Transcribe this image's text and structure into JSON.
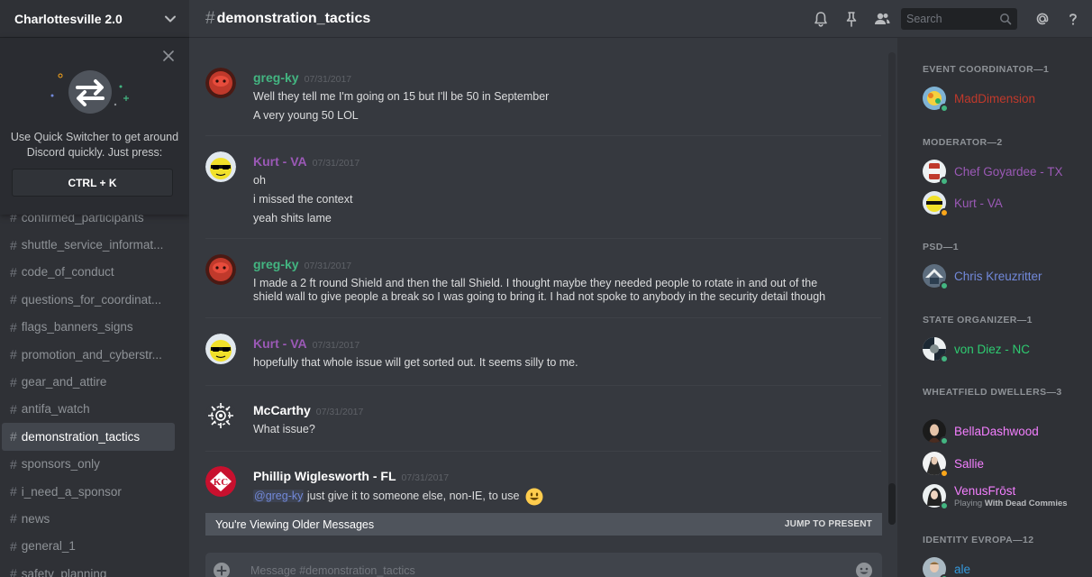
{
  "server": {
    "name": "Charlottesville 2.0"
  },
  "quick_switcher": {
    "text": "Use Quick Switcher to get around Discord quickly. Just press:",
    "key": "CTRL + K"
  },
  "channels": [
    {
      "name": "confirmed_participants",
      "active": false
    },
    {
      "name": "shuttle_service_informat...",
      "active": false
    },
    {
      "name": "code_of_conduct",
      "active": false
    },
    {
      "name": "questions_for_coordinat...",
      "active": false
    },
    {
      "name": "flags_banners_signs",
      "active": false
    },
    {
      "name": "promotion_and_cyberstr...",
      "active": false
    },
    {
      "name": "gear_and_attire",
      "active": false
    },
    {
      "name": "antifa_watch",
      "active": false
    },
    {
      "name": "demonstration_tactics",
      "active": true
    },
    {
      "name": "sponsors_only",
      "active": false
    },
    {
      "name": "i_need_a_sponsor",
      "active": false
    },
    {
      "name": "news",
      "active": false
    },
    {
      "name": "general_1",
      "active": false
    },
    {
      "name": "safety_planning",
      "active": false
    }
  ],
  "header": {
    "channel_name": "demonstration_tactics",
    "search_placeholder": "Search"
  },
  "messages": [
    {
      "author": "greg-ky",
      "author_color": "#43b581",
      "timestamp": "07/31/2017",
      "lines": [
        "Well they tell me I'm going on 15 but I'll be 50 in September",
        "A very young 50 LOL"
      ]
    },
    {
      "author": "Kurt - VA",
      "author_color": "#9b59b6",
      "timestamp": "07/31/2017",
      "lines": [
        "oh",
        "i missed the context",
        "yeah shits lame"
      ]
    },
    {
      "author": "greg-ky",
      "author_color": "#43b581",
      "timestamp": "07/31/2017",
      "lines": [
        "I made a 2 ft round Shield and then the tall Shield. I thought maybe they needed people to rotate in and out of the",
        "shield wall to give people a break so I was going to bring it. I had not spoke to anybody in the security detail though"
      ]
    },
    {
      "author": "Kurt - VA",
      "author_color": "#9b59b6",
      "timestamp": "07/31/2017",
      "lines": [
        "hopefully that whole issue will get sorted out. It seems silly to me."
      ]
    },
    {
      "author": "McCarthy",
      "author_color": "#ffffff",
      "timestamp": "07/31/2017",
      "lines": [
        "What issue?"
      ]
    },
    {
      "author": "Phillip Wiglesworth - FL",
      "author_color": "#ffffff",
      "timestamp": "07/31/2017",
      "mention": "@greg-ky",
      "text_after_mention": " just give it to someone else, non-IE, to use"
    }
  ],
  "older_bar": {
    "text": "You're Viewing Older Messages",
    "jump": "JUMP TO PRESENT"
  },
  "composer": {
    "placeholder": "Message #demonstration_tactics"
  },
  "member_groups": [
    {
      "role": "EVENT COORDINATOR—1",
      "members": [
        {
          "name": "MadDimension",
          "color": "#c0392b",
          "status": "#43b581"
        }
      ]
    },
    {
      "role": "MODERATOR—2",
      "members": [
        {
          "name": "Chef Goyardee - TX",
          "color": "#9b59b6",
          "status": "#43b581"
        },
        {
          "name": "Kurt - VA",
          "color": "#9b59b6",
          "status": "#faa61a"
        }
      ]
    },
    {
      "role": "PSD—1",
      "members": [
        {
          "name": "Chris Kreuzritter",
          "color": "#7289da",
          "status": "#43b581"
        }
      ]
    },
    {
      "role": "STATE ORGANIZER—1",
      "members": [
        {
          "name": "von Diez - NC",
          "color": "#2ecc71",
          "status": "#43b581"
        }
      ]
    },
    {
      "role": "WHEATFIELD DWELLERS—3",
      "members": [
        {
          "name": "BellaDashwood",
          "color": "#f47fff",
          "status": "#43b581"
        },
        {
          "name": "Sallie",
          "color": "#f47fff",
          "status": "#faa61a"
        },
        {
          "name": "VenusFrōst",
          "color": "#f47fff",
          "status": "#43b581",
          "activity_prefix": "Playing",
          "activity_game": "With Dead Commies"
        }
      ]
    },
    {
      "role": "IDENTITY EVROPA—12",
      "members": [
        {
          "name": "ale",
          "color": "#3498db",
          "status": "#43b581"
        }
      ]
    }
  ]
}
